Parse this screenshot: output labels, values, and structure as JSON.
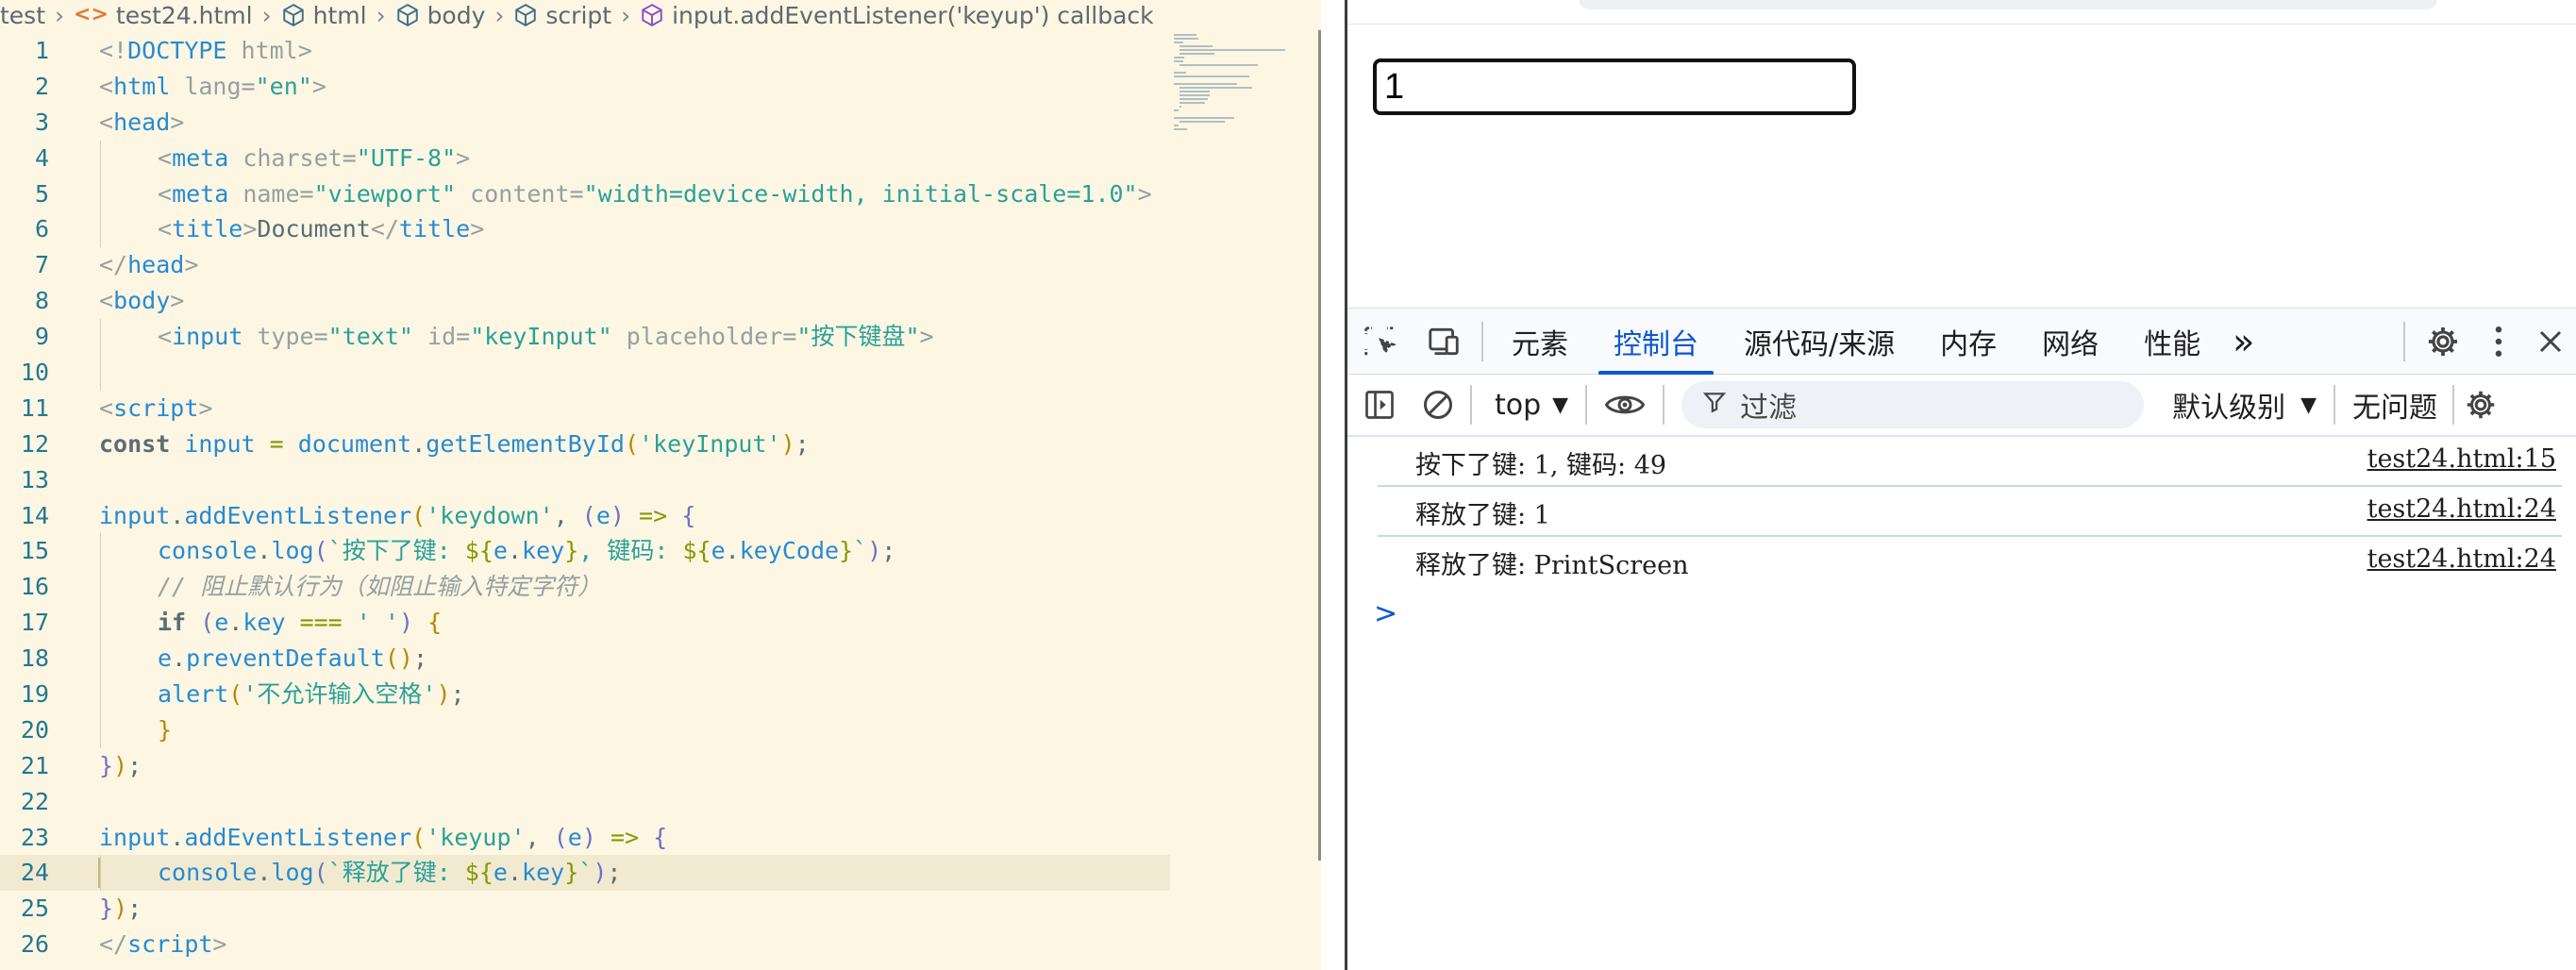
{
  "breadcrumb": {
    "items": [
      "test",
      "test24.html",
      "html",
      "body",
      "script",
      "input.addEventListener('keyup') callback"
    ]
  },
  "code_lines": [
    {
      "n": "1",
      "i": 0,
      "t": [
        [
          "pn",
          "<!"
        ],
        [
          "tg",
          "DOCTYPE"
        ],
        [
          "at",
          " html"
        ],
        [
          "pn",
          ">"
        ]
      ]
    },
    {
      "n": "2",
      "i": 0,
      "t": [
        [
          "pn",
          "<"
        ],
        [
          "tg",
          "html"
        ],
        [
          "at",
          " lang"
        ],
        [
          "pn",
          "="
        ],
        [
          "st",
          "\"en\""
        ],
        [
          "pn",
          ">"
        ]
      ]
    },
    {
      "n": "3",
      "i": 0,
      "t": [
        [
          "pn",
          "<"
        ],
        [
          "tg",
          "head"
        ],
        [
          "pn",
          ">"
        ]
      ]
    },
    {
      "n": "4",
      "i": 1,
      "t": [
        [
          "pn",
          "<"
        ],
        [
          "tg",
          "meta"
        ],
        [
          "at",
          " charset"
        ],
        [
          "pn",
          "="
        ],
        [
          "st",
          "\"UTF-8\""
        ],
        [
          "pn",
          ">"
        ]
      ]
    },
    {
      "n": "5",
      "i": 1,
      "t": [
        [
          "pn",
          "<"
        ],
        [
          "tg",
          "meta"
        ],
        [
          "at",
          " name"
        ],
        [
          "pn",
          "="
        ],
        [
          "st",
          "\"viewport\""
        ],
        [
          "at",
          " content"
        ],
        [
          "pn",
          "="
        ],
        [
          "st",
          "\"width=device-width, initial-scale=1.0\""
        ],
        [
          "pn",
          ">"
        ]
      ]
    },
    {
      "n": "6",
      "i": 1,
      "t": [
        [
          "pn",
          "<"
        ],
        [
          "tg",
          "title"
        ],
        [
          "pn",
          ">"
        ],
        [
          "tx",
          "Document"
        ],
        [
          "pn",
          "</"
        ],
        [
          "tg",
          "title"
        ],
        [
          "pn",
          ">"
        ]
      ]
    },
    {
      "n": "7",
      "i": 0,
      "t": [
        [
          "pn",
          "</"
        ],
        [
          "tg",
          "head"
        ],
        [
          "pn",
          ">"
        ]
      ]
    },
    {
      "n": "8",
      "i": 0,
      "t": [
        [
          "pn",
          "<"
        ],
        [
          "tg",
          "body"
        ],
        [
          "pn",
          ">"
        ]
      ]
    },
    {
      "n": "9",
      "i": 1,
      "t": [
        [
          "pn",
          "<"
        ],
        [
          "tg",
          "input"
        ],
        [
          "at",
          " type"
        ],
        [
          "pn",
          "="
        ],
        [
          "st",
          "\"text\""
        ],
        [
          "at",
          " id"
        ],
        [
          "pn",
          "="
        ],
        [
          "st",
          "\"keyInput\""
        ],
        [
          "at",
          " placeholder"
        ],
        [
          "pn",
          "="
        ],
        [
          "st",
          "\"按下键盘\""
        ],
        [
          "pn",
          ">"
        ]
      ]
    },
    {
      "n": "10",
      "i": 1,
      "t": []
    },
    {
      "n": "11",
      "i": 0,
      "t": [
        [
          "pn",
          "<"
        ],
        [
          "tg",
          "script"
        ],
        [
          "pn",
          ">"
        ]
      ]
    },
    {
      "n": "12",
      "i": 0,
      "t": [
        [
          "kw",
          "const"
        ],
        [
          "dt",
          " "
        ],
        [
          "vr",
          "input"
        ],
        [
          "dt",
          " "
        ],
        [
          "op",
          "="
        ],
        [
          "dt",
          " "
        ],
        [
          "vr",
          "document"
        ],
        [
          "dt",
          "."
        ],
        [
          "fn",
          "getElementById"
        ],
        [
          "br",
          "("
        ],
        [
          "st",
          "'keyInput'"
        ],
        [
          "br",
          ")"
        ],
        [
          "dt",
          ";"
        ]
      ]
    },
    {
      "n": "13",
      "i": 0,
      "t": []
    },
    {
      "n": "14",
      "i": 0,
      "t": [
        [
          "vr",
          "input"
        ],
        [
          "dt",
          "."
        ],
        [
          "fn",
          "addEventListener"
        ],
        [
          "br",
          "("
        ],
        [
          "st",
          "'keydown'"
        ],
        [
          "dt",
          ", "
        ],
        [
          "id",
          "("
        ],
        [
          "vr",
          "e"
        ],
        [
          "id",
          ")"
        ],
        [
          "dt",
          " "
        ],
        [
          "op",
          "=>"
        ],
        [
          "dt",
          " "
        ],
        [
          "id",
          "{"
        ]
      ]
    },
    {
      "n": "15",
      "i": 1,
      "t": [
        [
          "vr",
          "console"
        ],
        [
          "dt",
          "."
        ],
        [
          "fn",
          "log"
        ],
        [
          "id",
          "("
        ],
        [
          "tp",
          "`按下了键: "
        ],
        [
          "op",
          "${"
        ],
        [
          "vr",
          "e"
        ],
        [
          "dt",
          "."
        ],
        [
          "vr",
          "key"
        ],
        [
          "op",
          "}"
        ],
        [
          "tp",
          ", 键码: "
        ],
        [
          "op",
          "${"
        ],
        [
          "vr",
          "e"
        ],
        [
          "dt",
          "."
        ],
        [
          "vr",
          "keyCode"
        ],
        [
          "op",
          "}"
        ],
        [
          "tp",
          "`"
        ],
        [
          "id",
          ")"
        ],
        [
          "dt",
          ";"
        ]
      ]
    },
    {
      "n": "16",
      "i": 1,
      "t": [
        [
          "cm",
          "// 阻止默认行为（如阻止输入特定字符）"
        ]
      ]
    },
    {
      "n": "17",
      "i": 1,
      "t": [
        [
          "kw",
          "if"
        ],
        [
          "dt",
          " "
        ],
        [
          "id",
          "("
        ],
        [
          "vr",
          "e"
        ],
        [
          "dt",
          "."
        ],
        [
          "vr",
          "key"
        ],
        [
          "dt",
          " "
        ],
        [
          "op",
          "==="
        ],
        [
          "dt",
          " "
        ],
        [
          "st",
          "' '"
        ],
        [
          "id",
          ")"
        ],
        [
          "dt",
          " "
        ],
        [
          "br",
          "{"
        ]
      ]
    },
    {
      "n": "18",
      "i": 1,
      "t": [
        [
          "vr",
          "e"
        ],
        [
          "dt",
          "."
        ],
        [
          "fn",
          "preventDefault"
        ],
        [
          "br",
          "()"
        ],
        [
          "dt",
          ";"
        ]
      ]
    },
    {
      "n": "19",
      "i": 1,
      "t": [
        [
          "fn",
          "alert"
        ],
        [
          "br",
          "("
        ],
        [
          "st",
          "'不允许输入空格'"
        ],
        [
          "br",
          ")"
        ],
        [
          "dt",
          ";"
        ]
      ]
    },
    {
      "n": "20",
      "i": 1,
      "t": [
        [
          "br",
          "}"
        ]
      ]
    },
    {
      "n": "21",
      "i": 0,
      "t": [
        [
          "id",
          "}"
        ],
        [
          "br",
          ")"
        ],
        [
          "dt",
          ";"
        ]
      ]
    },
    {
      "n": "22",
      "i": 0,
      "t": []
    },
    {
      "n": "23",
      "i": 0,
      "t": [
        [
          "vr",
          "input"
        ],
        [
          "dt",
          "."
        ],
        [
          "fn",
          "addEventListener"
        ],
        [
          "br",
          "("
        ],
        [
          "st",
          "'keyup'"
        ],
        [
          "dt",
          ", "
        ],
        [
          "id",
          "("
        ],
        [
          "vr",
          "e"
        ],
        [
          "id",
          ")"
        ],
        [
          "dt",
          " "
        ],
        [
          "op",
          "=>"
        ],
        [
          "dt",
          " "
        ],
        [
          "id",
          "{"
        ]
      ]
    },
    {
      "n": "24",
      "i": 1,
      "t": [
        [
          "vr",
          "console"
        ],
        [
          "dt",
          "."
        ],
        [
          "fn",
          "log"
        ],
        [
          "id",
          "("
        ],
        [
          "tp",
          "`释放了键: "
        ],
        [
          "op",
          "${"
        ],
        [
          "vr",
          "e"
        ],
        [
          "dt",
          "."
        ],
        [
          "vr",
          "key"
        ],
        [
          "op",
          "}"
        ],
        [
          "tp",
          "`"
        ],
        [
          "id",
          ")"
        ],
        [
          "dt",
          ";"
        ]
      ],
      "active": true
    },
    {
      "n": "25",
      "i": 0,
      "t": [
        [
          "id",
          "}"
        ],
        [
          "br",
          ")"
        ],
        [
          "dt",
          ";"
        ]
      ]
    },
    {
      "n": "26",
      "i": 0,
      "t": [
        [
          "pn",
          "</"
        ],
        [
          "tg",
          "script"
        ],
        [
          "pn",
          ">"
        ]
      ]
    }
  ],
  "browser": {
    "input_value": "1"
  },
  "devtools": {
    "tabs": [
      "元素",
      "控制台",
      "源代码/来源",
      "内存",
      "网络",
      "性能"
    ],
    "selected_tab": "控制台",
    "more_tabs": "»",
    "context": "top",
    "filter_placeholder": "过滤",
    "level": "默认级别",
    "issues": "无问题",
    "messages": [
      {
        "text": "按下了键: 1, 键码: 49",
        "source": "test24.html:15"
      },
      {
        "text": "释放了键: 1",
        "source": "test24.html:24"
      },
      {
        "text": "释放了键: PrintScreen",
        "source": "test24.html:24"
      }
    ],
    "prompt": ">"
  },
  "colors": {
    "editor_bg": "#fdf6e3",
    "accent": "#0b57d0"
  }
}
